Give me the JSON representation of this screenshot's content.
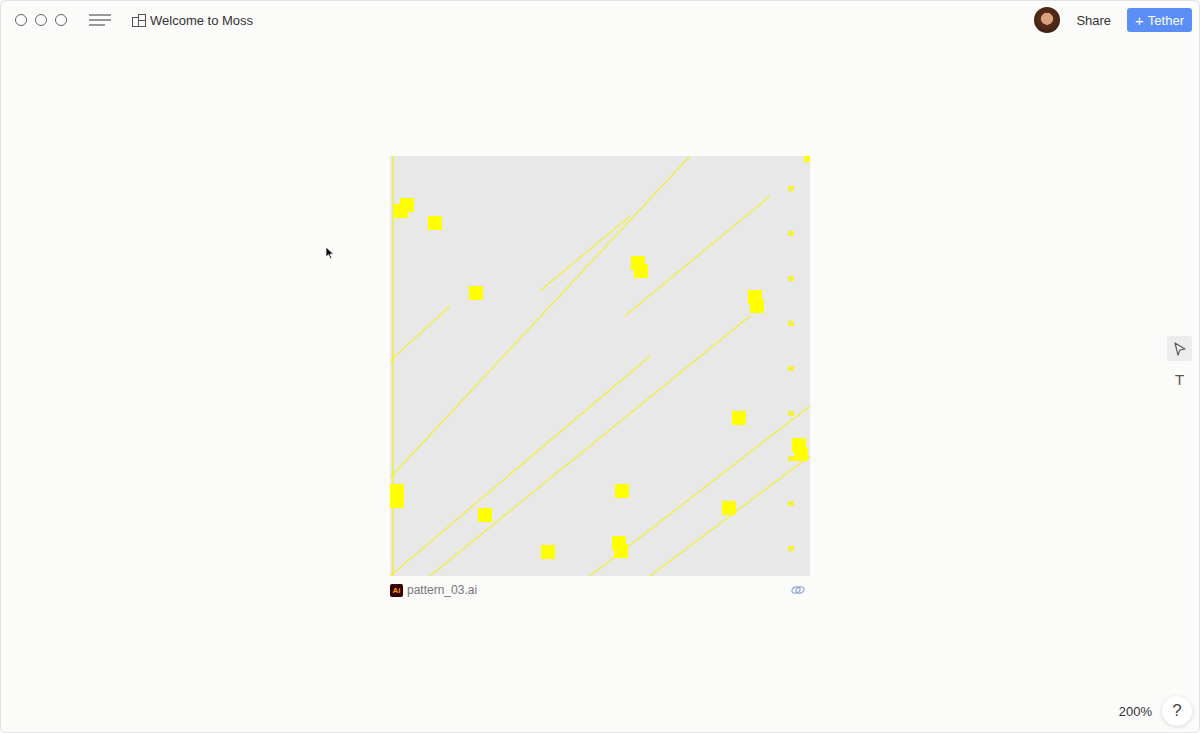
{
  "window": {
    "title": "Welcome to Moss"
  },
  "toolbar": {
    "share": "Share",
    "tether": {
      "icon": "+",
      "label": "Tether"
    }
  },
  "canvas": {
    "artwork": {
      "filename": "pattern_03.ai",
      "badge": "Ai"
    },
    "tools": [
      {
        "kind": "pointer",
        "selected": true
      },
      {
        "kind": "text",
        "glyph": "T",
        "selected": false
      }
    ],
    "zoom": "200%",
    "help": "?"
  }
}
